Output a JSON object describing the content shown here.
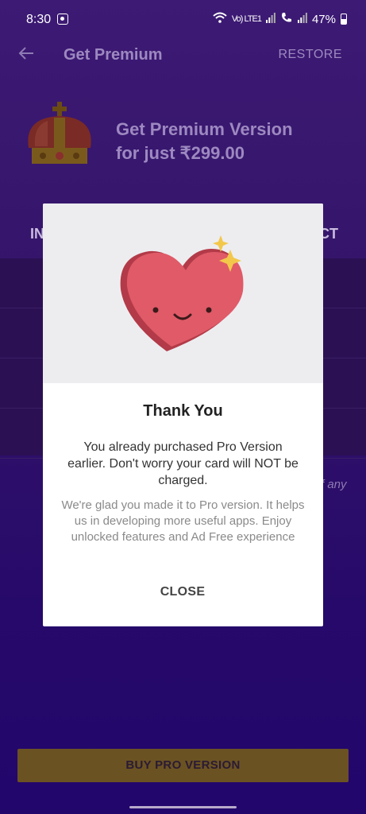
{
  "status_bar": {
    "time": "8:30",
    "network_label": "Vo) LTE1",
    "battery_text": "47%"
  },
  "app_bar": {
    "title": "Get Premium",
    "restore_label": "RESTORE"
  },
  "promo": {
    "title_line1": "Get Premium Version",
    "title_line2": "for just ₹299.00"
  },
  "background": {
    "tab_left_partial": "IN",
    "tab_right_partial": "CT",
    "note_partial": "f any"
  },
  "dialog": {
    "title": "Thank You",
    "message": "You already purchased Pro Version earlier. Don't worry your card will NOT be charged.",
    "sub_message": "We're glad you made it to Pro version. It helps us in developing more useful apps. Enjoy unlocked features and Ad Free experience",
    "close_label": "CLOSE"
  },
  "bottom": {
    "buy_label": "BUY PRO VERSION"
  },
  "colors": {
    "background_top": "#3d1a74",
    "background_bottom": "#22066b",
    "buy_button": "#6b5222",
    "heart": "#e05a68"
  }
}
